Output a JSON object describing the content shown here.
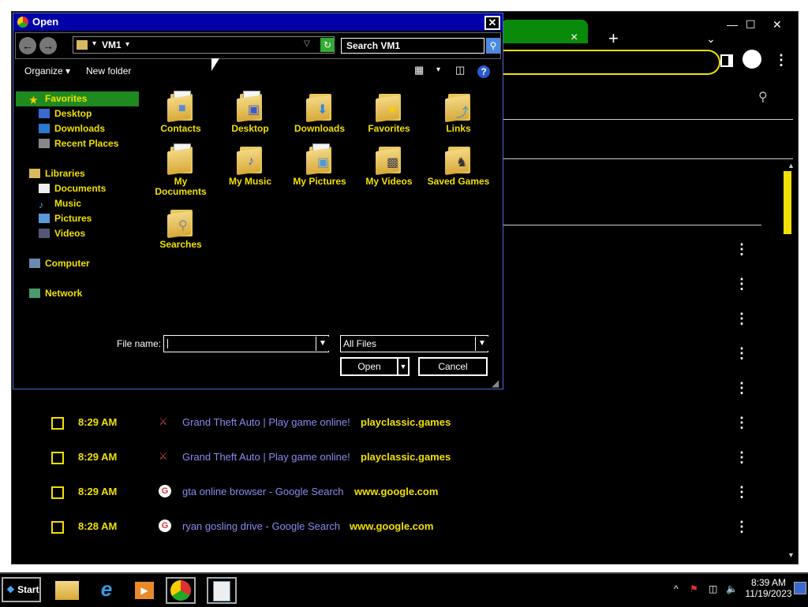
{
  "chrome": {
    "new_tab_symbol": "+",
    "tab_close_symbol": "×",
    "tab_list_symbol": "⌄",
    "minimize_symbol": "—",
    "maximize_symbol": "☐",
    "close_symbol": "✕",
    "kebab_symbol": "⋮",
    "search_icon": "search-icon",
    "history_rows": [
      {
        "time": "8:29 AM",
        "title": "Grand Theft Auto | Play game online!",
        "domain": "playclassic.games",
        "favicon": "gta"
      },
      {
        "time": "8:29 AM",
        "title": "Grand Theft Auto | Play game online!",
        "domain": "playclassic.games",
        "favicon": "gta"
      },
      {
        "time": "8:29 AM",
        "title": "gta online browser - Google Search",
        "domain": "www.google.com",
        "favicon": "google"
      },
      {
        "time": "8:28 AM",
        "title": "ryan gosling drive - Google Search",
        "domain": "www.google.com",
        "favicon": "google"
      }
    ]
  },
  "dialog": {
    "title": "Open",
    "close_symbol": "✕",
    "address": {
      "crumb": "VM1",
      "search_placeholder": "Search VM1"
    },
    "toolbar": {
      "organize": "Organize",
      "new_folder": "New folder",
      "help": "?"
    },
    "nav": {
      "favorites": {
        "label": "Favorites",
        "items": [
          "Desktop",
          "Downloads",
          "Recent Places"
        ]
      },
      "libraries": {
        "label": "Libraries",
        "items": [
          "Documents",
          "Music",
          "Pictures",
          "Videos"
        ]
      },
      "computer": "Computer",
      "network": "Network"
    },
    "folders": [
      {
        "label": "Contacts",
        "icon": "contacts-icon"
      },
      {
        "label": "Desktop",
        "icon": "desktop-icon"
      },
      {
        "label": "Downloads",
        "icon": "downloads-icon"
      },
      {
        "label": "Favorites",
        "icon": "star-icon"
      },
      {
        "label": "Links",
        "icon": "link-icon"
      },
      {
        "label": "My Documents",
        "icon": "document-icon"
      },
      {
        "label": "My Music",
        "icon": "music-icon"
      },
      {
        "label": "My Pictures",
        "icon": "picture-icon"
      },
      {
        "label": "My Videos",
        "icon": "video-icon"
      },
      {
        "label": "Saved Games",
        "icon": "chess-icon"
      },
      {
        "label": "Searches",
        "icon": "magnifier-icon"
      }
    ],
    "filename_label": "File name:",
    "filename_value": "",
    "filter_value": "All Files",
    "open_label": "Open",
    "cancel_label": "Cancel"
  },
  "taskbar": {
    "start_label": "Start",
    "time": "8:39 AM",
    "date": "11/19/2023"
  }
}
